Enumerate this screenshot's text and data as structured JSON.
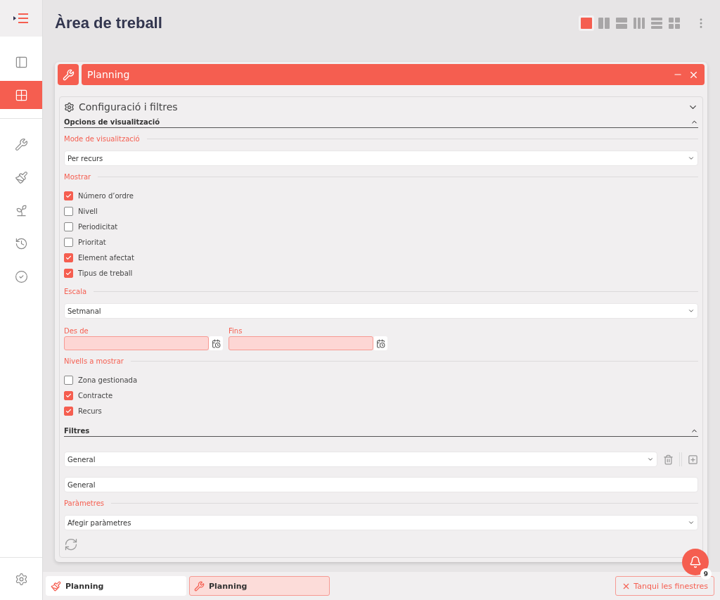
{
  "sidebar": {
    "items": [
      {
        "kind": "layout",
        "selected": false
      },
      {
        "kind": "grid",
        "selected": true
      },
      {
        "kind": "wrench",
        "selected": false
      },
      {
        "kind": "brush",
        "selected": false
      },
      {
        "kind": "sprout",
        "selected": false
      },
      {
        "kind": "history",
        "selected": false
      },
      {
        "kind": "check",
        "selected": false
      }
    ]
  },
  "header": {
    "title": "Àrea de treball",
    "layouts": [
      {
        "kind": "single",
        "selected": true
      },
      {
        "kind": "cols2",
        "selected": false
      },
      {
        "kind": "rows2",
        "selected": false
      },
      {
        "kind": "cols3",
        "selected": false
      },
      {
        "kind": "rows3",
        "selected": false
      },
      {
        "kind": "grid",
        "selected": false
      }
    ]
  },
  "window": {
    "title": "Planning",
    "panel": {
      "title": "Configuració i filtres",
      "sections": [
        {
          "title": "Opcions de visualització",
          "expanded": true,
          "items": [
            {
              "kind": "heading",
              "label": "Mode de visualització"
            },
            {
              "kind": "select",
              "value": "Per recurs"
            },
            {
              "kind": "heading",
              "label": "Mostrar"
            },
            {
              "kind": "checkboxes",
              "options": [
                {
                  "label": "Número d’ordre",
                  "checked": true
                },
                {
                  "label": "Nivell",
                  "checked": false
                },
                {
                  "label": "Periodicitat",
                  "checked": false
                },
                {
                  "label": "Prioritat",
                  "checked": false
                },
                {
                  "label": "Element afectat",
                  "checked": true
                },
                {
                  "label": "Tipus de treball",
                  "checked": true
                }
              ]
            },
            {
              "kind": "heading",
              "label": "Escala"
            },
            {
              "kind": "select",
              "value": "Setmanal"
            },
            {
              "kind": "dates",
              "fields": [
                {
                  "label": "Des de"
                },
                {
                  "label": "Fins"
                }
              ]
            },
            {
              "kind": "heading",
              "label": "Nivells a mostrar"
            },
            {
              "kind": "checkboxes",
              "options": [
                {
                  "label": "Zona gestionada",
                  "checked": false
                },
                {
                  "label": "Contracte",
                  "checked": true
                },
                {
                  "label": "Recurs",
                  "checked": true
                }
              ]
            }
          ]
        },
        {
          "title": "Filtres",
          "expanded": true,
          "items": [
            {
              "kind": "filter_select",
              "value": "General"
            },
            {
              "kind": "input",
              "value": "General"
            },
            {
              "kind": "heading",
              "label": "Paràmetres"
            },
            {
              "kind": "select",
              "value": "Afegir paràmetres"
            }
          ]
        }
      ]
    }
  },
  "taskbar": {
    "tasks": [
      {
        "kind": "brush",
        "title": "Planning",
        "selected": false
      },
      {
        "kind": "wrench",
        "title": "Planning",
        "selected": true
      }
    ],
    "close_all": "Tanqui les finestres",
    "notifications": "9"
  }
}
